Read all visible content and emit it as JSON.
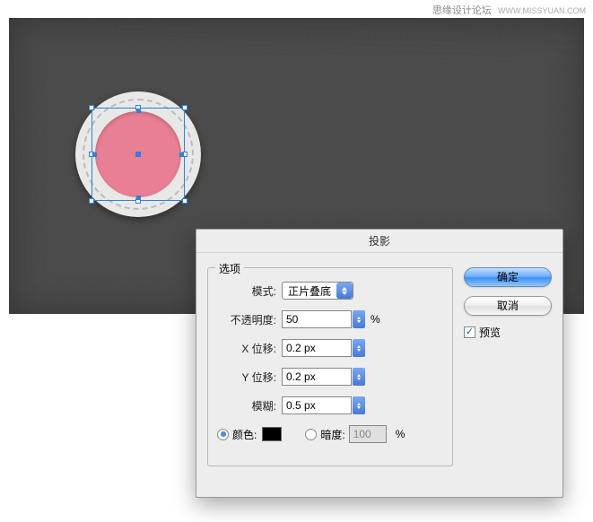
{
  "watermark": {
    "site": "思缘设计论坛",
    "url": "WWW.MISSYUAN.COM"
  },
  "dialog": {
    "title": "投影",
    "options_legend": "选项",
    "mode_label": "模式:",
    "mode_value": "正片叠底",
    "opacity_label": "不透明度:",
    "opacity_value": "50",
    "opacity_unit": "%",
    "x_offset_label": "X 位移:",
    "x_offset_value": "0.2 px",
    "y_offset_label": "Y 位移:",
    "y_offset_value": "0.2 px",
    "blur_label": "模糊:",
    "blur_value": "0.5 px",
    "color_label": "颜色:",
    "darkness_label": "暗度:",
    "darkness_value": "100",
    "darkness_unit": "%",
    "ok_label": "确定",
    "cancel_label": "取消",
    "preview_label": "预览",
    "checkmark": "✓"
  }
}
